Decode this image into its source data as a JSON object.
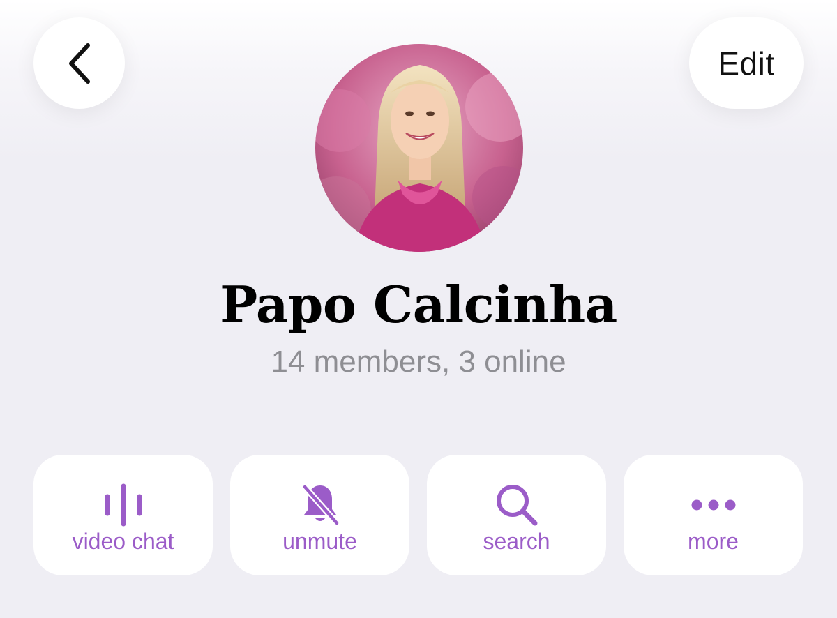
{
  "header": {
    "back_icon": "chevron-left-icon",
    "edit_label": "Edit"
  },
  "profile": {
    "name": "Papo Calcinha",
    "subtitle": "14 members, 3 online"
  },
  "actions": [
    {
      "label": "video chat",
      "icon": "voice-chat-icon"
    },
    {
      "label": "unmute",
      "icon": "bell-slash-icon"
    },
    {
      "label": "search",
      "icon": "search-icon"
    },
    {
      "label": "more",
      "icon": "more-dots-icon"
    }
  ],
  "colors": {
    "accent": "#9b5cc8",
    "background": "#efeef4",
    "secondary_text": "#8e8e93"
  }
}
